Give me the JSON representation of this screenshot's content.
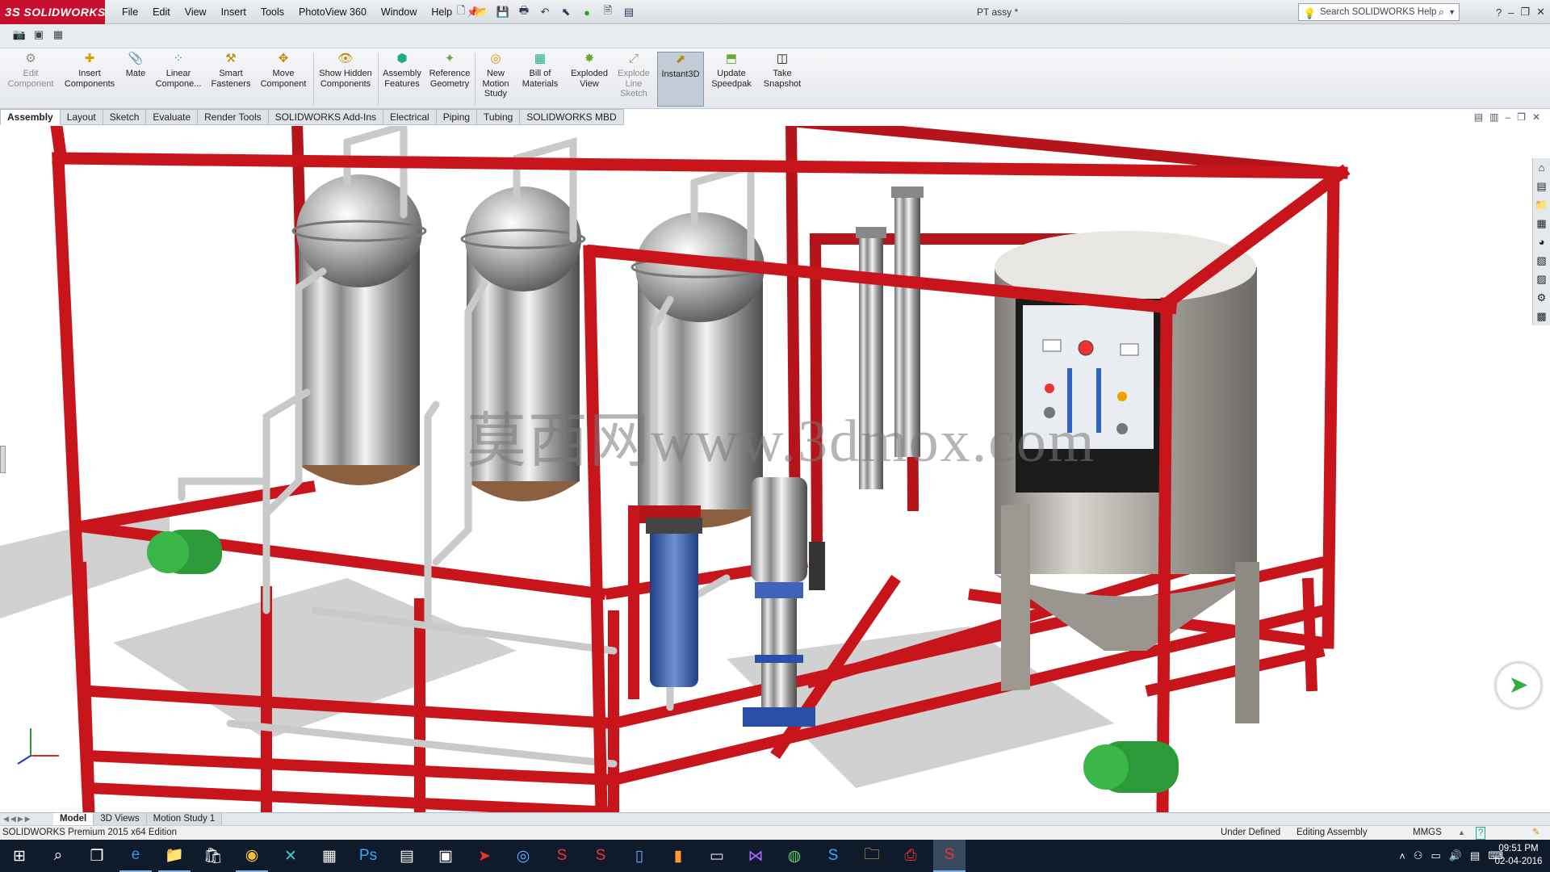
{
  "app": {
    "logo_text": "SOLIDWORKS",
    "logo_mark": "3S",
    "document_title": "PT assy *"
  },
  "menu": [
    "File",
    "Edit",
    "View",
    "Insert",
    "Tools",
    "PhotoView 360",
    "Window",
    "Help"
  ],
  "search": {
    "placeholder": "Search SOLIDWORKS Help"
  },
  "window_controls": {
    "help": "?",
    "minimize": "–",
    "restore": "❐",
    "close": "✕"
  },
  "command_manager": {
    "edit_component": "Edit Component",
    "insert_components": "Insert Components",
    "mate": "Mate",
    "linear_component": "Linear Compone...",
    "smart_fasteners": "Smart Fasteners",
    "move_component": "Move Component",
    "show_hidden": "Show Hidden Components",
    "assembly_features": "Assembly Features",
    "reference_geometry": "Reference Geometry",
    "new_motion_study": "New Motion Study",
    "bill_of_materials": "Bill of Materials",
    "exploded_view": "Exploded View",
    "explode_line_sketch": "Explode Line Sketch",
    "instant3d": "Instant3D",
    "update_speedpak": "Update Speedpak",
    "take_snapshot": "Take Snapshot"
  },
  "tabs": [
    "Assembly",
    "Layout",
    "Sketch",
    "Evaluate",
    "Render Tools",
    "SOLIDWORKS Add-Ins",
    "Electrical",
    "Piping",
    "Tubing",
    "SOLIDWORKS MBD"
  ],
  "active_tab": "Assembly",
  "viewport": {
    "watermark": "莫西网www.3dmox.com"
  },
  "bottom_tabs": [
    "Model",
    "3D Views",
    "Motion Study 1"
  ],
  "status": {
    "edition": "SOLIDWORKS Premium 2015 x64 Edition",
    "definition": "Under Defined",
    "mode": "Editing Assembly",
    "units": "MMGS"
  },
  "clock": {
    "time": "09:51 PM",
    "date": "02-04-2016"
  },
  "colors": {
    "frame_red": "#c8151b",
    "brand_red": "#c8102e",
    "taskbar": "#0f1b2b",
    "pump_green": "#2d9a3a"
  }
}
